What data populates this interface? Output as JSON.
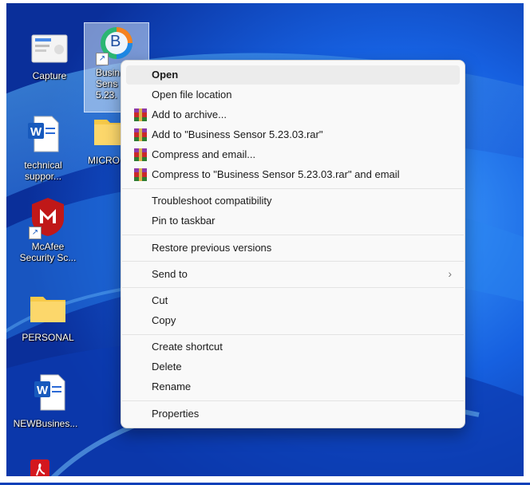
{
  "desktop": {
    "icons": [
      {
        "label": "5"
      },
      {
        "label": "Capture"
      },
      {
        "label": "Busin Sens 5.23."
      },
      {
        "label": "technical suppor..."
      },
      {
        "label": "MICRO"
      },
      {
        "label": "McAfee Security Sc..."
      },
      {
        "label": "PERSONAL"
      },
      {
        "label": "NEWBusines..."
      }
    ],
    "icon_badge": "B"
  },
  "menu": {
    "items": [
      {
        "label": "Open"
      },
      {
        "label": "Open file location"
      },
      {
        "label": "Add to archive..."
      },
      {
        "label": "Add to \"Business Sensor 5.23.03.rar\""
      },
      {
        "label": "Compress and email..."
      },
      {
        "label": "Compress to \"Business Sensor 5.23.03.rar\" and email"
      },
      {
        "label": "Troubleshoot compatibility"
      },
      {
        "label": "Pin to taskbar"
      },
      {
        "label": "Restore previous versions"
      },
      {
        "label": "Send to"
      },
      {
        "label": "Cut"
      },
      {
        "label": "Copy"
      },
      {
        "label": "Create shortcut"
      },
      {
        "label": "Delete"
      },
      {
        "label": "Rename"
      },
      {
        "label": "Properties"
      }
    ],
    "submenu_chevron": "›"
  },
  "colors": {
    "wallpaper": "#0a3fb8",
    "menu_bg": "#f9f9f9",
    "highlight": "#ececec"
  }
}
